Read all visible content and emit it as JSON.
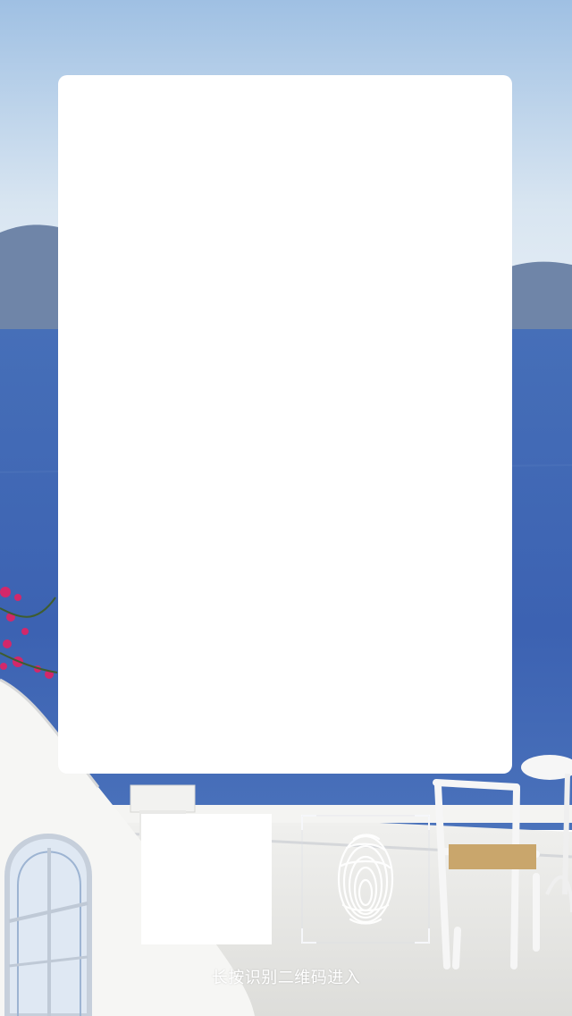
{
  "screen": {
    "hint_text": "长按识别二维码进入"
  },
  "icons": {
    "fingerprint": "fingerprint-icon"
  },
  "colors": {
    "card_background": "#ffffff",
    "hint_text": "#ffffff",
    "sea": "#3f63b7",
    "sky": "#cfe0ef"
  }
}
